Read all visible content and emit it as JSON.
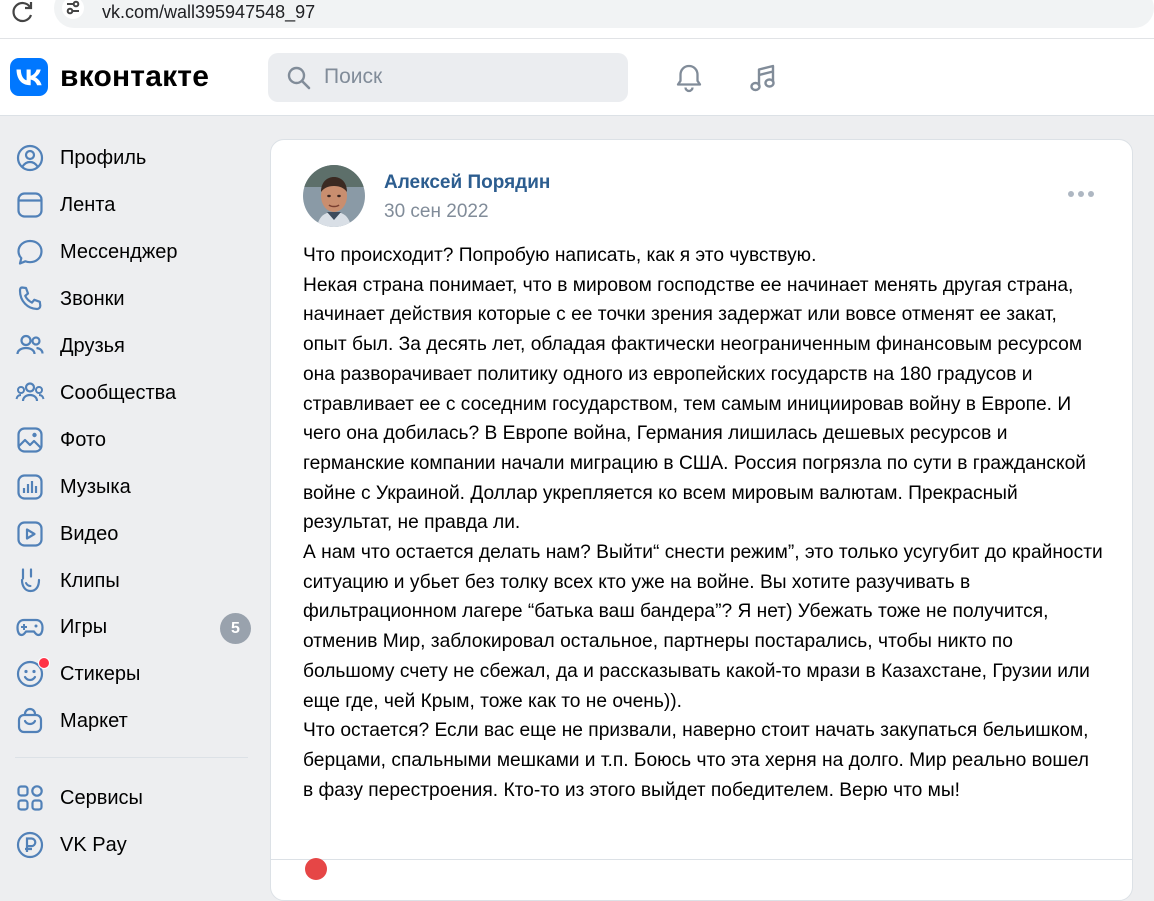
{
  "browser": {
    "url": "vk.com/wall395947548_97"
  },
  "header": {
    "logo_text": "вконтакте",
    "search_placeholder": "Поиск"
  },
  "sidebar": {
    "items": [
      {
        "label": "Профиль",
        "icon": "profile-icon"
      },
      {
        "label": "Лента",
        "icon": "feed-icon"
      },
      {
        "label": "Мессенджер",
        "icon": "messenger-icon"
      },
      {
        "label": "Звонки",
        "icon": "phone-icon"
      },
      {
        "label": "Друзья",
        "icon": "friends-icon"
      },
      {
        "label": "Сообщества",
        "icon": "communities-icon"
      },
      {
        "label": "Фото",
        "icon": "photo-icon"
      },
      {
        "label": "Музыка",
        "icon": "music-icon"
      },
      {
        "label": "Видео",
        "icon": "video-icon"
      },
      {
        "label": "Клипы",
        "icon": "clips-icon"
      },
      {
        "label": "Игры",
        "icon": "games-icon",
        "badge": "5"
      },
      {
        "label": "Стикеры",
        "icon": "stickers-icon"
      },
      {
        "label": "Маркет",
        "icon": "market-icon"
      },
      {
        "label": "Сервисы",
        "icon": "services-icon"
      },
      {
        "label": "VK Pay",
        "icon": "vkpay-icon"
      }
    ]
  },
  "post": {
    "author": "Алексей Порядин",
    "date": "30 сен 2022",
    "text": "Что происходит? Попробую написать, как я это чувствую.\nНекая страна понимает, что в мировом господстве ее начинает менять другая страна, начинает действия которые с ее точки зрения задержат или вовсе отменят ее закат, опыт был. За десять лет, обладая фактически неограниченным финансовым ресурсом она разворачивает политику одного из европейских государств на 180 градусов и стравливает ее с соседним государством, тем самым инициировав войну в Европе. И чего она добилась? В Европе война, Германия лишилась дешевых ресурсов и германские компании начали миграцию в США. Россия погрязла по сути в гражданской войне с Украиной. Доллар укрепляется ко всем мировым валютам. Прекрасный результат, не правда ли.\nА нам что остается делать нам? Выйти“ снести режим”, это только усугубит до крайности ситуацию и убьет без толку всех кто уже на войне. Вы хотите разучивать в фильтрационном лагере “батька ваш бандера”? Я нет) Убежать тоже не получится, отменив Мир, заблокировал остальное, партнеры постарались, чтобы никто по большому счету не сбежал, да и рассказывать какой-то мрази в Казахстане, Грузии или еще где, чей Крым, тоже как то не очень)).\nЧто остается? Если вас еще не призвали, наверно стоит начать закупаться бельишком, берцами, спальными мешками и т.п. Боюсь что эта херня на долго. Мир реально вошел в фазу перестроения. Кто-то из этого выйдет победителем. Верю что мы!"
  },
  "colors": {
    "accent": "#0077ff",
    "author_link": "#2c5d8f",
    "secondary_text": "#818c99",
    "icon": "#5181b8",
    "badge": "#99a2ad",
    "notification_dot": "#ff3347"
  }
}
